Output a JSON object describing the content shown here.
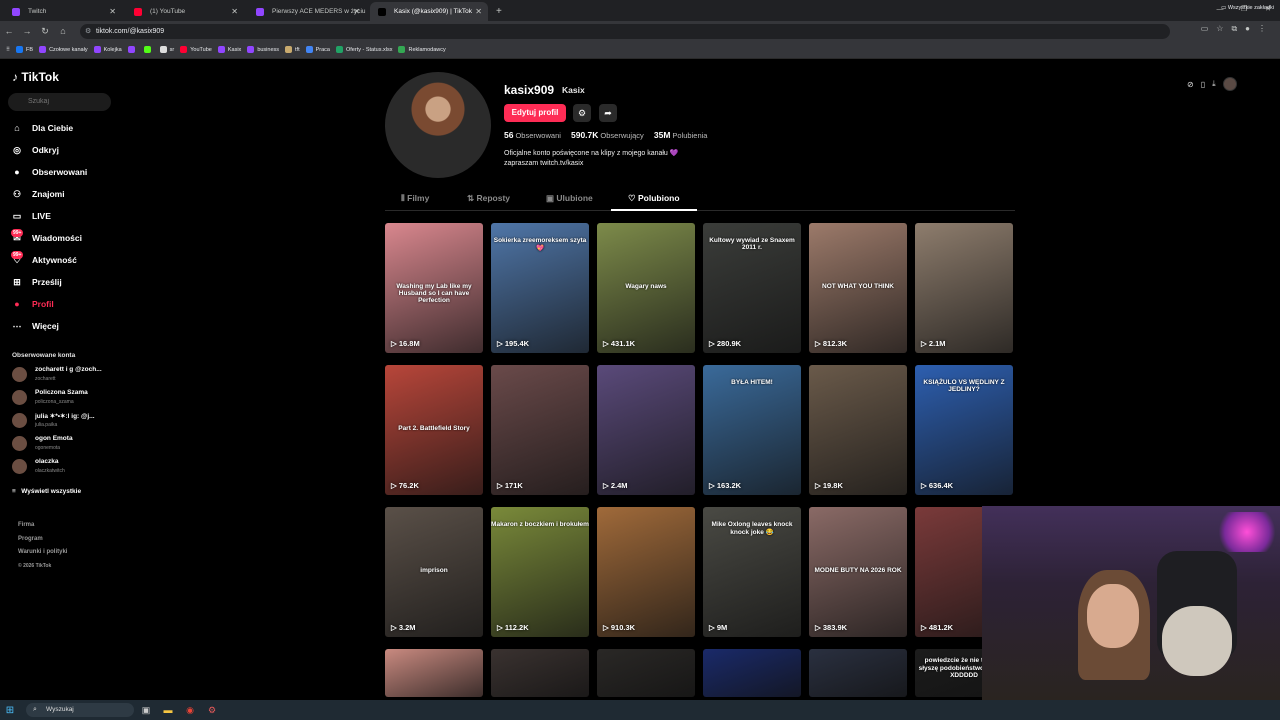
{
  "browser": {
    "tabs": [
      {
        "title": "Twitch",
        "color": "#9146ff",
        "active": false
      },
      {
        "title": "(1) YouTube",
        "color": "#ff0033",
        "active": false
      },
      {
        "title": "Pierwszy ACE MEDERS w życiu",
        "color": "#9146ff",
        "active": false
      },
      {
        "title": "Kasix (@kasix909) | TikTok",
        "color": "#000000",
        "active": true
      }
    ],
    "url": "tiktok.com/@kasix909",
    "bookmarks": [
      {
        "label": "FB",
        "color": "#1877f2"
      },
      {
        "label": "Czołowe kanały",
        "color": "#9146ff"
      },
      {
        "label": "Kolejka",
        "color": "#9146ff"
      },
      {
        "label": "",
        "color": "#9146ff"
      },
      {
        "label": "",
        "color": "#53fc18"
      },
      {
        "label": "sr",
        "color": "#dddddd"
      },
      {
        "label": "YouTube",
        "color": "#ff0033"
      },
      {
        "label": "Kasix",
        "color": "#9146ff"
      },
      {
        "label": "business",
        "color": "#9146ff"
      },
      {
        "label": "tft",
        "color": "#c8aa6e"
      },
      {
        "label": "Praca",
        "color": "#4285f4"
      },
      {
        "label": "Oferty - Status.xlsx",
        "color": "#21a366"
      },
      {
        "label": "Reklamodawcy",
        "color": "#34a853"
      }
    ],
    "all_bookmarks": "Wszystkie zakładki"
  },
  "sidebar": {
    "logo": "TikTok",
    "search_placeholder": "Szukaj",
    "nav": [
      {
        "label": "Dla Ciebie",
        "icon": "home-icon",
        "glyph": "⌂"
      },
      {
        "label": "Odkryj",
        "icon": "compass-icon",
        "glyph": "◎"
      },
      {
        "label": "Obserwowani",
        "icon": "following-icon",
        "glyph": "●"
      },
      {
        "label": "Znajomi",
        "icon": "friends-icon",
        "glyph": "⚇"
      },
      {
        "label": "LIVE",
        "icon": "live-icon",
        "glyph": "▭"
      },
      {
        "label": "Wiadomości",
        "icon": "messages-icon",
        "glyph": "✉",
        "badge": "99+"
      },
      {
        "label": "Aktywność",
        "icon": "activity-icon",
        "glyph": "♡",
        "badge": "99+"
      },
      {
        "label": "Prześlij",
        "icon": "upload-icon",
        "glyph": "⊞"
      },
      {
        "label": "Profil",
        "icon": "profile-icon",
        "glyph": "●",
        "active": true
      },
      {
        "label": "Więcej",
        "icon": "more-icon",
        "glyph": "⋯"
      }
    ],
    "following_title": "Obserwowane konta",
    "following": [
      {
        "name": "zocharett i g @zoch...",
        "handle": "zocharett"
      },
      {
        "name": "Policzona Szama",
        "handle": "policzona_szama"
      },
      {
        "name": "julia ✶*•✶ːl ig: @j...",
        "handle": "julia.paika"
      },
      {
        "name": "ogon Emota",
        "handle": "ogonemota"
      },
      {
        "name": "olaczka",
        "handle": "olaczkatwitch"
      }
    ],
    "show_all": "Wyświetl wszystkie",
    "footer": [
      "Firma",
      "Program",
      "Warunki i polityki"
    ],
    "copyright": "© 2026 TikTok"
  },
  "profile": {
    "username": "kasix909",
    "nickname": "Kasix",
    "edit_label": "Edytuj profil",
    "stats": [
      {
        "value": "56",
        "label": "Obserwowani"
      },
      {
        "value": "590.7K",
        "label": "Obserwujący"
      },
      {
        "value": "35M",
        "label": "Polubienia"
      }
    ],
    "bio_line1": "Oficjalne konto poświęcone na klipy z mojego kanału 💜",
    "bio_line2": "zapraszam twitch.tv/kasix"
  },
  "tabs": [
    {
      "label": "Filmy",
      "icon": "grid-icon",
      "glyph": "⦀"
    },
    {
      "label": "Reposty",
      "icon": "repost-icon",
      "glyph": "⇅"
    },
    {
      "label": "Ulubione",
      "icon": "bookmark-icon",
      "glyph": "▣"
    },
    {
      "label": "Polubiono",
      "icon": "heart-icon",
      "glyph": "♡",
      "active": true
    }
  ],
  "videos": [
    {
      "views": "16.8M",
      "caption": "Washing my Lab like my Husband so I can have Perfection",
      "bg": "#d9878e"
    },
    {
      "views": "195.4K",
      "caption": "Sokierka zreemoreksem szyta 💖",
      "bg": "#4f76a8"
    },
    {
      "views": "431.1K",
      "caption": "Wagary naws",
      "bg": "#7d8b4a"
    },
    {
      "views": "280.9K",
      "caption": "Kultowy wywiad ze Snaxem 2011 r.",
      "bg": "#3b3d3a"
    },
    {
      "views": "812.3K",
      "caption": "NOT WHAT YOU THINK",
      "bg": "#9c7a6a"
    },
    {
      "views": "2.1M",
      "caption": "",
      "bg": "#8e7d6d"
    },
    {
      "views": "76.2K",
      "caption": "Part 2. Battlefield Story",
      "bg": "#b8463a"
    },
    {
      "views": "171K",
      "caption": "",
      "bg": "#6a4a4a"
    },
    {
      "views": "2.4M",
      "caption": "",
      "bg": "#5a4a7a"
    },
    {
      "views": "163.2K",
      "caption": "BYŁA HITEM!",
      "bg": "#3a6a9a"
    },
    {
      "views": "19.8K",
      "caption": "",
      "bg": "#6a5a4a"
    },
    {
      "views": "636.4K",
      "caption": "KSIĄŻULO VS WĘDLINY Z JEDLINY?",
      "bg": "#2d5fb0"
    },
    {
      "views": "3.2M",
      "caption": "imprison",
      "bg": "#5a5048"
    },
    {
      "views": "112.2K",
      "caption": "Makaron z boczkiem i brokułem",
      "bg": "#7a8a3a"
    },
    {
      "views": "910.3K",
      "caption": "",
      "bg": "#a06a3a"
    },
    {
      "views": "9M",
      "caption": "Mike Oxlong leaves knock knock joke 😂",
      "bg": "#4a4a44"
    },
    {
      "views": "383.9K",
      "caption": "MODNE BUTY NA 2026 ROK",
      "bg": "#8a6a66"
    },
    {
      "views": "481.2K",
      "caption": "",
      "bg": "#7a3a3a"
    },
    {
      "views": "",
      "caption": "",
      "bg": "#c98a80"
    },
    {
      "views": "",
      "caption": "",
      "bg": "#3a3230"
    },
    {
      "views": "",
      "caption": "",
      "bg": "#2a2826"
    },
    {
      "views": "",
      "caption": "",
      "bg": "#1a2a6a"
    },
    {
      "views": "",
      "caption": "",
      "bg": "#2a3040"
    },
    {
      "views": "",
      "caption": "powiedzcie że nie tylko ja słyszę podobieństwo 😂 tego XDDDDD",
      "bg": "#1c1c1c"
    }
  ],
  "taskbar": {
    "search_placeholder": "Wyszukaj"
  },
  "colors": {
    "accent": "#fe2c55",
    "background": "#000000"
  }
}
